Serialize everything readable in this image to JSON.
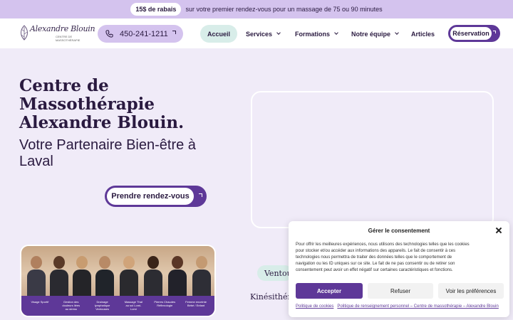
{
  "promo": {
    "badge": "15$ de rabais",
    "text": "sur votre premier rendez-vous pour un massage de 75 ou 90 minutes"
  },
  "header": {
    "logo_script": "Alexandre Blouin",
    "logo_tagline": "CENTRE DE MASSOTHÉRAPIE",
    "phone": "450-241-1211",
    "nav": [
      {
        "label": "Accueil"
      },
      {
        "label": "Services"
      },
      {
        "label": "Formations"
      },
      {
        "label": "Notre équipe"
      },
      {
        "label": "Articles"
      }
    ],
    "reserve_label": "Réservation"
  },
  "hero": {
    "title": "Centre de Massothérapie Alexandre Blouin.",
    "subtitle": "Votre Partenaire Bien-être à Laval",
    "cta_label": "Prendre rendez-vous"
  },
  "team": {
    "labels": [
      "Visage Sportif",
      "Gestion des douleurs liées au stress",
      "Drainage lymphatique Ventouses",
      "Massage Thaï au sol Lomi-Lomi",
      "Pierres Chaudes Réflexologie",
      "Femme enceinte Bébé / Enfant"
    ]
  },
  "services_pills": {
    "first": "Ventouses",
    "second": "Kinésithérapie"
  },
  "consent": {
    "title": "Gérer le consentement",
    "body": "Pour offrir les meilleures expériences, nous utilisons des technologies telles que les cookies pour stocker et/ou accéder aux informations des appareils. Le fait de consentir à ces technologies nous permettra de traiter des données telles que le comportement de navigation ou les ID uniques sur ce site. Le fait de ne pas consentir ou de retirer son consentement peut avoir un effet négatif sur certaines caractéristiques et fonctions.",
    "accept": "Accepter",
    "refuse": "Refuser",
    "prefs": "Voir les préférences",
    "link_cookies": "Politique de cookies",
    "link_privacy": "Politique de renseignement personnel – Centre de massothérapie – Alexandre Blouin"
  },
  "colors": {
    "accent": "#5e3898",
    "lavender": "#d4c3ee",
    "mint": "#d8ede9",
    "background": "#f0ebf8",
    "text": "#2a1a40"
  }
}
